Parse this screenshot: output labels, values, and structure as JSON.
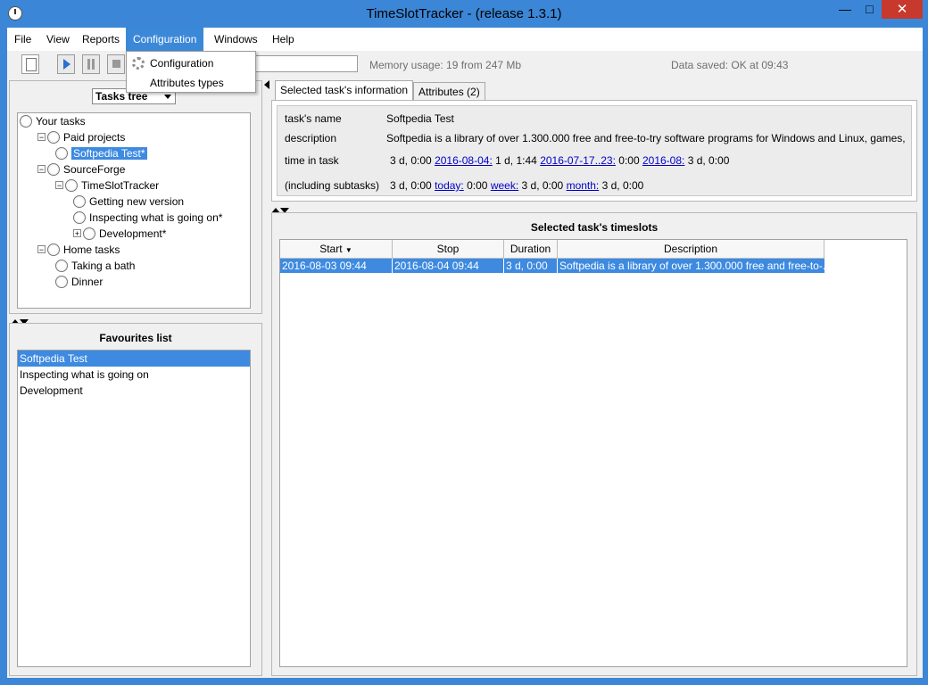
{
  "window": {
    "title": "TimeSlotTracker - (release 1.3.1)",
    "minimize_glyph": "—",
    "maximize_glyph": "□",
    "close_glyph": "✕"
  },
  "menu": {
    "items": [
      "File",
      "View",
      "Reports",
      "Configuration",
      "Windows",
      "Help"
    ],
    "active": "Configuration",
    "dropdown": [
      "Configuration",
      "Attributes types"
    ]
  },
  "toolbar": {
    "memory": "Memory usage: 19 from 247 Mb",
    "data_saved": "Data saved: OK at 09:43"
  },
  "left": {
    "tree_selector": "Tasks tree",
    "tree": [
      {
        "label": "Your tasks",
        "level": 0,
        "expander": "",
        "selected": false
      },
      {
        "label": "Paid projects",
        "level": 1,
        "expander": "−",
        "selected": false
      },
      {
        "label": "Softpedia Test*",
        "level": 2,
        "expander": "",
        "selected": true
      },
      {
        "label": "SourceForge",
        "level": 1,
        "expander": "−",
        "selected": false
      },
      {
        "label": "TimeSlotTracker",
        "level": 2,
        "expander": "−",
        "selected": false
      },
      {
        "label": "Getting new version",
        "level": 3,
        "expander": "",
        "selected": false
      },
      {
        "label": "Inspecting what is going on*",
        "level": 3,
        "expander": "",
        "selected": false
      },
      {
        "label": "Development*",
        "level": 3,
        "expander": "+",
        "selected": false
      },
      {
        "label": "Home tasks",
        "level": 1,
        "expander": "−",
        "selected": false
      },
      {
        "label": "Taking a bath",
        "level": 2,
        "expander": "",
        "selected": false
      },
      {
        "label": "Dinner",
        "level": 2,
        "expander": "",
        "selected": false
      }
    ],
    "favourites_title": "Favourites list",
    "favourites": [
      "Softpedia Test",
      "Inspecting what is going on",
      "Development"
    ],
    "favourites_selected_index": 0
  },
  "tabs": [
    "Selected task's information",
    "Attributes (2)"
  ],
  "info": {
    "name_label": "task's name",
    "name_value": "Softpedia Test",
    "desc_label": "description",
    "desc_value": "Softpedia is a library of over 1.300.000 free and free-to-try software programs for Windows and Linux, games, ...",
    "time_label": "time in task",
    "time_total": "3 d, 0:00",
    "time_link1": "2016-08-04:",
    "time_val1": "1 d, 1:44",
    "time_link2": "2016-07-17..23:",
    "time_val2": "0:00",
    "time_link3": "2016-08:",
    "time_val3": "3 d, 0:00",
    "sub_label": "(including subtasks)",
    "sub_total": "3 d, 0:00",
    "sub_link1": "today:",
    "sub_val1": "0:00",
    "sub_link2": "week:",
    "sub_val2": "3 d, 0:00",
    "sub_link3": "month:",
    "sub_val3": "3 d, 0:00"
  },
  "timeslots": {
    "title": "Selected task's timeslots",
    "columns": [
      "Start",
      "Stop",
      "Duration",
      "Description"
    ],
    "sort_glyph": "▼",
    "rows": [
      [
        "2016-08-03 09:44",
        "2016-08-04 09:44",
        "3 d, 0:00",
        "Softpedia is a library of over 1.300.000 free and free-to-..."
      ]
    ]
  },
  "colors": {
    "titlebar": "#3b86d6",
    "selection": "#3d8ae0",
    "close": "#c7392c"
  }
}
